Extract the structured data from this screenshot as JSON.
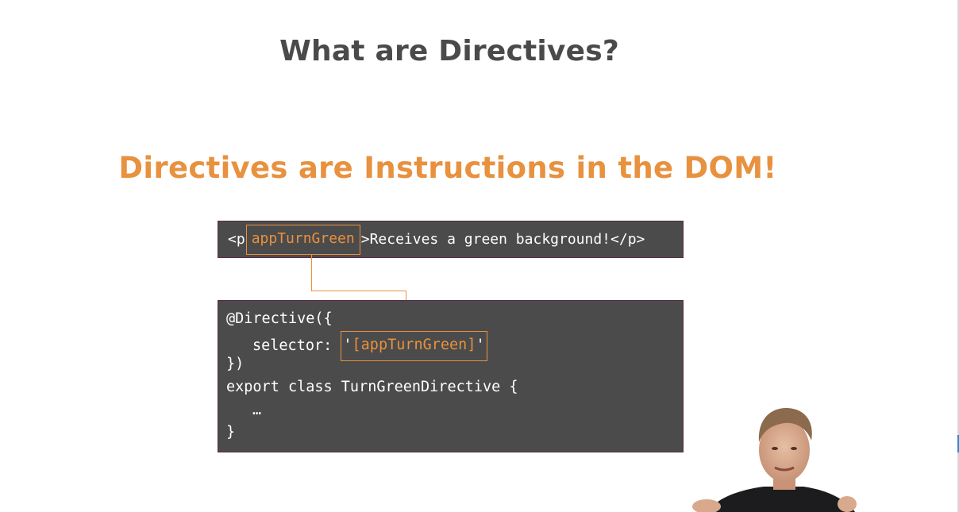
{
  "slide": {
    "title": "What are Directives?",
    "subtitle": "Directives are Instructions in the DOM!"
  },
  "html_example": {
    "open_tag": "<p",
    "attribute": "appTurnGreen",
    "close_bracket": ">",
    "content": "Receives a green background!",
    "end_tag": "</p>"
  },
  "directive_code": {
    "line1": "@Directive({",
    "selector_key": "selector:",
    "quote": "'",
    "selector_value": "[appTurnGreen]",
    "line3": "})",
    "line4": "export class TurnGreenDirective {",
    "line5": "…",
    "line6": "}"
  },
  "colors": {
    "accent": "#e8913f",
    "code_background": "#4b4b4b",
    "title": "#4a4a4a"
  }
}
